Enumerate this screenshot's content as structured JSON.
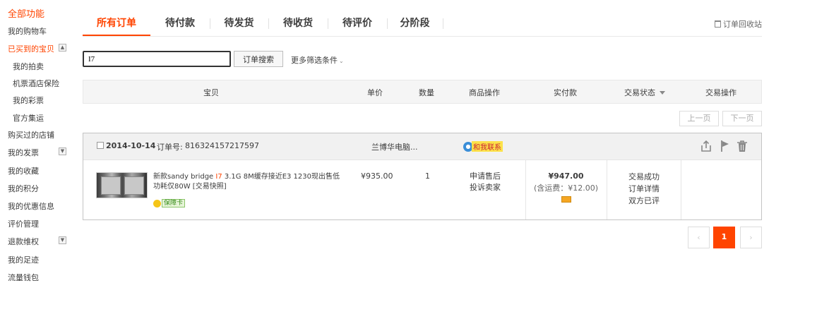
{
  "sidebar": {
    "title": "全部功能",
    "items": [
      {
        "label": "我的购物车"
      },
      {
        "label": "已买到的宝贝"
      },
      {
        "label": "我的拍卖"
      },
      {
        "label": "机票酒店保险"
      },
      {
        "label": "我的彩票"
      },
      {
        "label": "官方集运"
      },
      {
        "label": "购买过的店铺"
      },
      {
        "label": "我的发票"
      },
      {
        "label": "我的收藏"
      },
      {
        "label": "我的积分"
      },
      {
        "label": "我的优惠信息"
      },
      {
        "label": "评价管理"
      },
      {
        "label": "退款维权"
      },
      {
        "label": "我的足迹"
      },
      {
        "label": "流量钱包"
      }
    ],
    "toggles": {
      "expanded": "▲",
      "collapsed": "▼"
    }
  },
  "tabs": [
    "所有订单",
    "待付款",
    "待发货",
    "待收货",
    "待评价",
    "分阶段"
  ],
  "recycle_bin": "订单回收站",
  "search": {
    "value": "I7",
    "button": "订单搜索",
    "more_filters": "更多筛选条件"
  },
  "table_header": {
    "columns": [
      "宝贝",
      "单价",
      "数量",
      "商品操作",
      "实付款",
      "交易状态",
      "交易操作"
    ]
  },
  "pager_top": {
    "prev": "上一页",
    "next": "下一页"
  },
  "order": {
    "date": "2014-10-14",
    "order_no_label": "订单号:",
    "order_no": "816324157217597",
    "shop": "兰博华电脑...",
    "contact": "和我联系",
    "item": {
      "title_prefix": "新款sandy bridge ",
      "title_highlight": "I7",
      "title_suffix": " 3.1G 8M缓存接近E3 1230现出售低功耗仅80W [交易快照]",
      "guarantee": "保障卡",
      "price": "¥935.00",
      "quantity": "1",
      "ops": [
        "申请售后",
        "投诉卖家"
      ]
    },
    "paid": {
      "amount": "¥947.00",
      "shipping": "(含运费：¥12.00)"
    },
    "status": [
      "交易成功",
      "订单详情",
      "双方已评"
    ]
  },
  "pager": {
    "prev": "‹",
    "current": "1",
    "next": "›"
  },
  "colors": {
    "accent": "#ff4400",
    "header_bg": "#f5f5f5"
  }
}
